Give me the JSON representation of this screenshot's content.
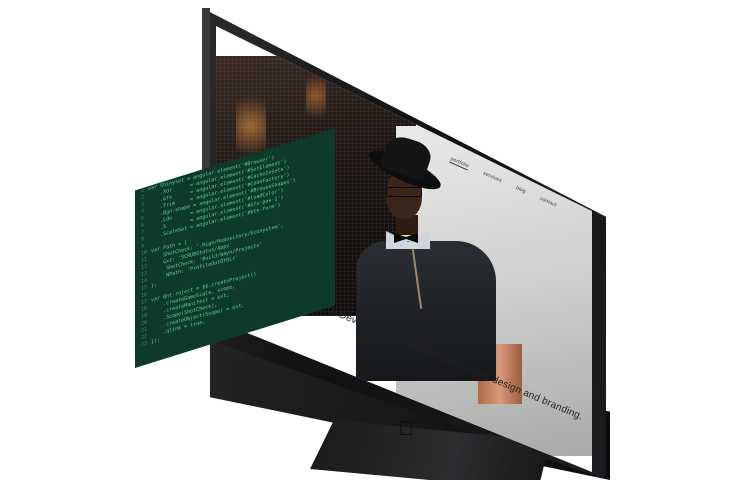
{
  "website": {
    "nav": [
      {
        "label": "portfolio",
        "active": true
      },
      {
        "label": "services",
        "active": false
      },
      {
        "label": "blog",
        "active": false
      },
      {
        "label": "contact",
        "active": false
      }
    ],
    "tagline": "We are UI Devices and we create efficientweb design and branding.",
    "menu_icon": "hamburger-menu-icon"
  },
  "monitor": {
    "brand_icon": "apple-logo-icon"
  },
  "code_panel": {
    "lines": [
      {
        "n": "1",
        "t": "var Shinyset = angular.element('#Browser')"
      },
      {
        "n": "2",
        "t": "    .Xdr      = angular.element('#SetElement')"
      },
      {
        "n": "3",
        "t": "    .Gfx      = angular.element('#CacheInSets')"
      },
      {
        "n": "4",
        "t": "    .Trim     = angular.element('#CodeFactory')"
      },
      {
        "n": "5",
        "t": "    .Bgn-shape = angular.element('#BrowseShapes')"
      },
      {
        "n": "6",
        "t": "    .Ldn      = angular.element('#loadColor')"
      },
      {
        "n": "7",
        "t": "    .S        = angular.element('#Gfx-pos-i')"
      },
      {
        "n": "8",
        "t": "    .ScaleSet = angular.element('#btn-form')"
      },
      {
        "n": "9",
        "t": ""
      },
      {
        "n": "10",
        "t": "var Path = {"
      },
      {
        "n": "11",
        "t": "    ShotCheck: '.Rigs/Repository/Ecosystem',"
      },
      {
        "n": "12",
        "t": "    Gxt: 'SCRUBStatus/Apps'"
      },
      {
        "n": "13",
        "t": "    _ShotCheck: 'Build/bayn/Projects'"
      },
      {
        "n": "14",
        "t": "    _NPath: 'ProfileOutOfDir'"
      },
      {
        "n": "15",
        "t": "};"
      },
      {
        "n": "16",
        "t": ""
      },
      {
        "n": "17",
        "t": "var Qnt-roject = $$.createProject()"
      },
      {
        "n": "18",
        "t": "    .createGameScale, scope,"
      },
      {
        "n": "19",
        "t": "    .createManifest = ext,"
      },
      {
        "n": "20",
        "t": "    .Scope(ShotCheck),"
      },
      {
        "n": "21",
        "t": "    .createObject(Scope) = ext,"
      },
      {
        "n": "22",
        "t": "    .qlink = true,"
      },
      {
        "n": "23",
        "t": "});"
      }
    ]
  }
}
